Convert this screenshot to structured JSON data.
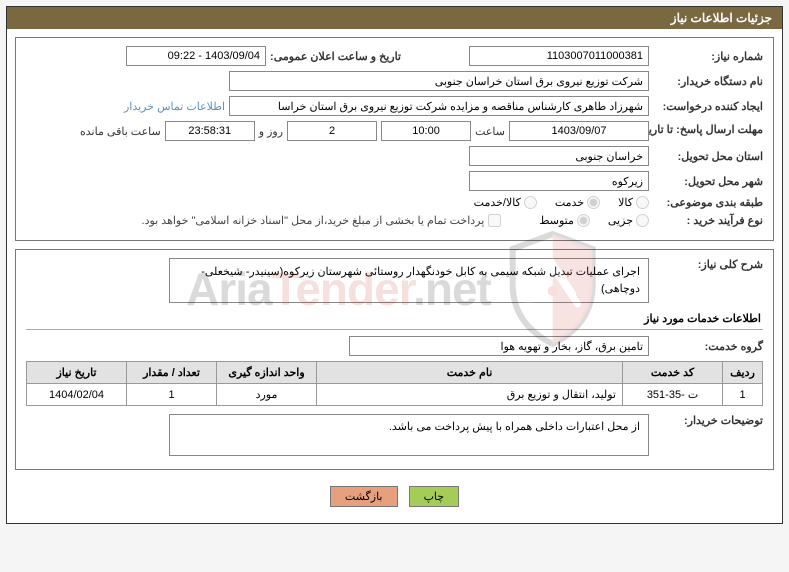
{
  "panel_title": "جزئیات اطلاعات نیاز",
  "fields": {
    "need_number_label": "شماره نیاز:",
    "need_number": "1103007011000381",
    "announce_date_label": "تاریخ و ساعت اعلان عمومی:",
    "announce_date": "1403/09/04 - 09:22",
    "buyer_org_label": "نام دستگاه خریدار:",
    "buyer_org": "شرکت توزیع نیروی برق استان خراسان جنوبی",
    "requester_label": "ایجاد کننده درخواست:",
    "requester": "شهرزاد طاهری کارشناس مناقصه و مزایده شرکت توزیع نیروی برق استان خراسا",
    "contact_link": "اطلاعات تماس خریدار",
    "deadline_label": "مهلت ارسال پاسخ: تا تاریخ:",
    "deadline_date": "1403/09/07",
    "time_word": "ساعت",
    "deadline_time": "10:00",
    "days_remaining": "2",
    "days_word": "روز و",
    "time_remaining": "23:58:31",
    "remaining_word": "ساعت باقی مانده",
    "delivery_province_label": "استان محل تحویل:",
    "delivery_province": "خراسان جنوبی",
    "delivery_city_label": "شهر محل تحویل:",
    "delivery_city": "زیرکوه",
    "category_label": "طبقه بندی موضوعی:",
    "cat_goods": "کالا",
    "cat_service": "خدمت",
    "cat_goods_service": "کالا/خدمت",
    "purchase_type_label": "نوع فرآیند خرید :",
    "pt_partial": "جزیی",
    "pt_medium": "متوسط",
    "treasury_note": "پرداخت تمام یا بخشی از مبلغ خرید،از محل \"اسناد خزانه اسلامی\" خواهد بود.",
    "summary_label": "شرح کلی نیاز:",
    "summary": "اجرای عملیات تبدیل شبکه سیمی به کابل خودنگهدار روستائی شهرستان زیرکوه(سینیدر- شیخعلی- دوچاهی)",
    "services_section_title": "اطلاعات خدمات مورد نیاز",
    "service_group_label": "گروه خدمت:",
    "service_group": "تامین برق، گاز، بخار و تهویه هوا",
    "buyer_desc_label": "توضیحات خریدار:",
    "buyer_desc": "از محل اعتبارات داخلی همراه با پیش پرداخت می باشد."
  },
  "table": {
    "headers": {
      "row": "ردیف",
      "code": "کد خدمت",
      "name": "نام خدمت",
      "unit": "واحد اندازه گیری",
      "qty": "تعداد / مقدار",
      "need_date": "تاریخ نیاز"
    },
    "rows": [
      {
        "row": "1",
        "code": "ت -35-351",
        "name": "تولید، انتقال و توزیع برق",
        "unit": "مورد",
        "qty": "1",
        "need_date": "1404/02/04"
      }
    ]
  },
  "buttons": {
    "print": "چاپ",
    "back": "بازگشت"
  },
  "watermark": {
    "text_before": "Aria",
    "text_mid": "Tender",
    "text_after": ".net"
  },
  "selections": {
    "category": "service",
    "purchase_type": "medium",
    "treasury": false
  }
}
